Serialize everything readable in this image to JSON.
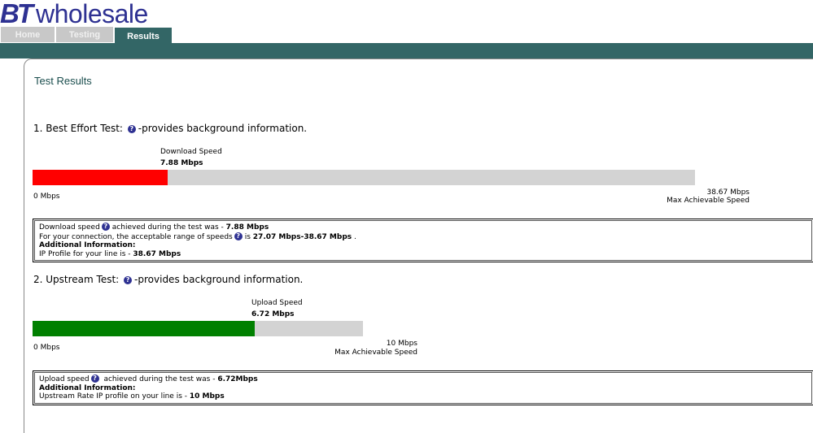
{
  "logo": {
    "brand": "BT",
    "word": "wholesale"
  },
  "tabs": [
    {
      "label": "Home"
    },
    {
      "label": "Testing"
    },
    {
      "label": "Results"
    }
  ],
  "page_title": "Test Results",
  "colors": {
    "accent": "#336666",
    "download_fill": "#ff0000",
    "upload_fill": "#008000",
    "track": "#d3d3d3",
    "logo": "#2e3192"
  },
  "best_effort": {
    "title": "1. Best Effort Test:",
    "help_icon": "question-icon",
    "desc": "-provides background information.",
    "speed_label": "Download Speed",
    "speed_value": "7.88 Mbps",
    "speed_mbps": 7.88,
    "max_mbps": 38.67,
    "min_label": "0 Mbps",
    "max_label": "38.67 Mbps",
    "max_caption": "Max Achievable Speed",
    "info": {
      "line1_pre": "Download speed",
      "line1_mid": "achieved during the test was - ",
      "line1_val": "7.88 Mbps",
      "line2_pre": "For your connection, the acceptable range of speeds",
      "line2_mid": "is ",
      "line2_val": "27.07 Mbps-38.67 Mbps",
      "line2_end": " .",
      "additional": "Additional Information:",
      "line3_pre": "IP Profile for your line is - ",
      "line3_val": "38.67 Mbps"
    }
  },
  "upstream": {
    "title": "2. Upstream Test:",
    "help_icon": "question-icon",
    "desc": "-provides background information.",
    "speed_label": "Upload Speed",
    "speed_value": "6.72 Mbps",
    "speed_mbps": 6.72,
    "max_mbps": 10,
    "min_label": "0 Mbps",
    "max_label": "10 Mbps",
    "max_caption": "Max Achievable Speed",
    "info": {
      "line1_pre": "Upload speed",
      "line1_mid": " achieved during the test was - ",
      "line1_val": "6.72Mbps",
      "additional": "Additional Information:",
      "line2_pre": "Upstream Rate IP profile on your line is - ",
      "line2_val": "10 Mbps"
    }
  }
}
